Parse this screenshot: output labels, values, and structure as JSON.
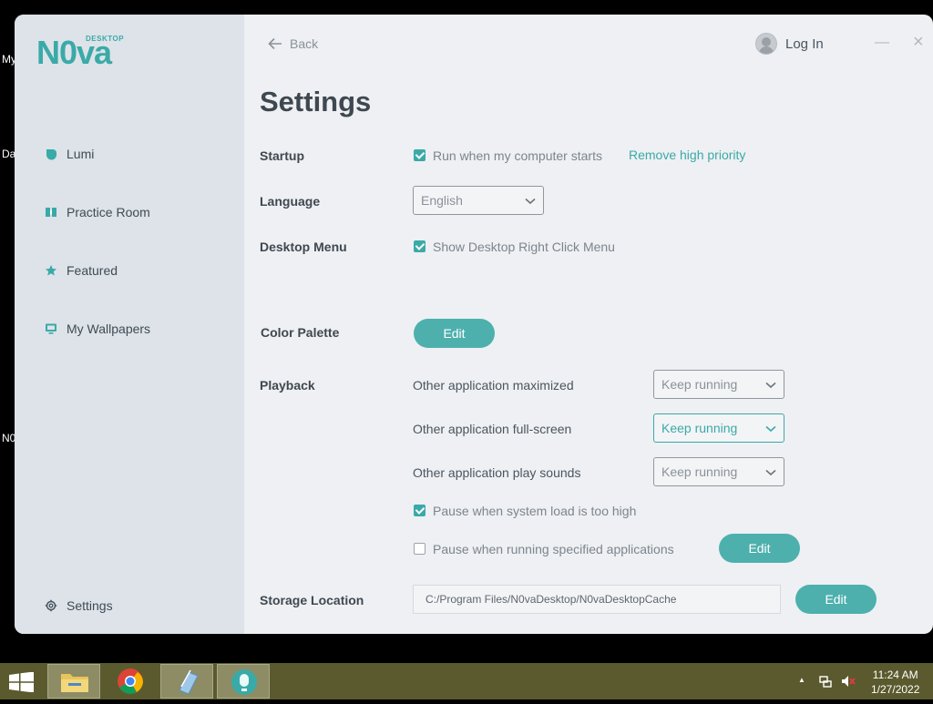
{
  "app": {
    "logo_small": "DESKTOP",
    "logo_main": "N0va"
  },
  "sidebar": {
    "items": [
      {
        "label": "Lumi"
      },
      {
        "label": "Practice Room"
      },
      {
        "label": "Featured"
      },
      {
        "label": "My Wallpapers"
      }
    ],
    "settings_label": "Settings"
  },
  "topbar": {
    "back_label": "Back",
    "login_label": "Log In",
    "minimize": "—",
    "close": "×"
  },
  "page": {
    "title": "Settings"
  },
  "startup": {
    "label": "Startup",
    "run_on_start": {
      "label": "Run when my computer starts",
      "checked": true
    },
    "priority_link": "Remove high priority"
  },
  "language": {
    "label": "Language",
    "value": "English"
  },
  "desktop_menu": {
    "label": "Desktop Menu",
    "option": {
      "label": "Show Desktop Right Click Menu",
      "checked": true
    }
  },
  "color_palette": {
    "label": "Color Palette",
    "button": "Edit"
  },
  "playback": {
    "label": "Playback",
    "rows": [
      {
        "label": "Other application maximized",
        "value": "Keep running"
      },
      {
        "label": "Other application full-screen",
        "value": "Keep running"
      },
      {
        "label": "Other application play sounds",
        "value": "Keep running"
      }
    ],
    "pause_high_load": {
      "label": "Pause when system load is too high",
      "checked": true
    },
    "pause_apps": {
      "label": "Pause when running specified applications",
      "checked": false
    },
    "pause_apps_button": "Edit"
  },
  "storage": {
    "label": "Storage Location",
    "path": "C:/Program Files/N0vaDesktop/N0vaDesktopCache",
    "button": "Edit"
  },
  "desktop_underlay": {
    "frag1": "My",
    "frag2": "Da",
    "frag3": "N0"
  },
  "taskbar": {
    "time": "11:24 AM",
    "date": "1/27/2022",
    "tray_up": "▲"
  },
  "colors": {
    "accent": "#3aaaa8",
    "sidebar_bg": "#dde3e8",
    "content_bg": "#eef0f3",
    "taskbar_bg": "#5a5a2e"
  }
}
